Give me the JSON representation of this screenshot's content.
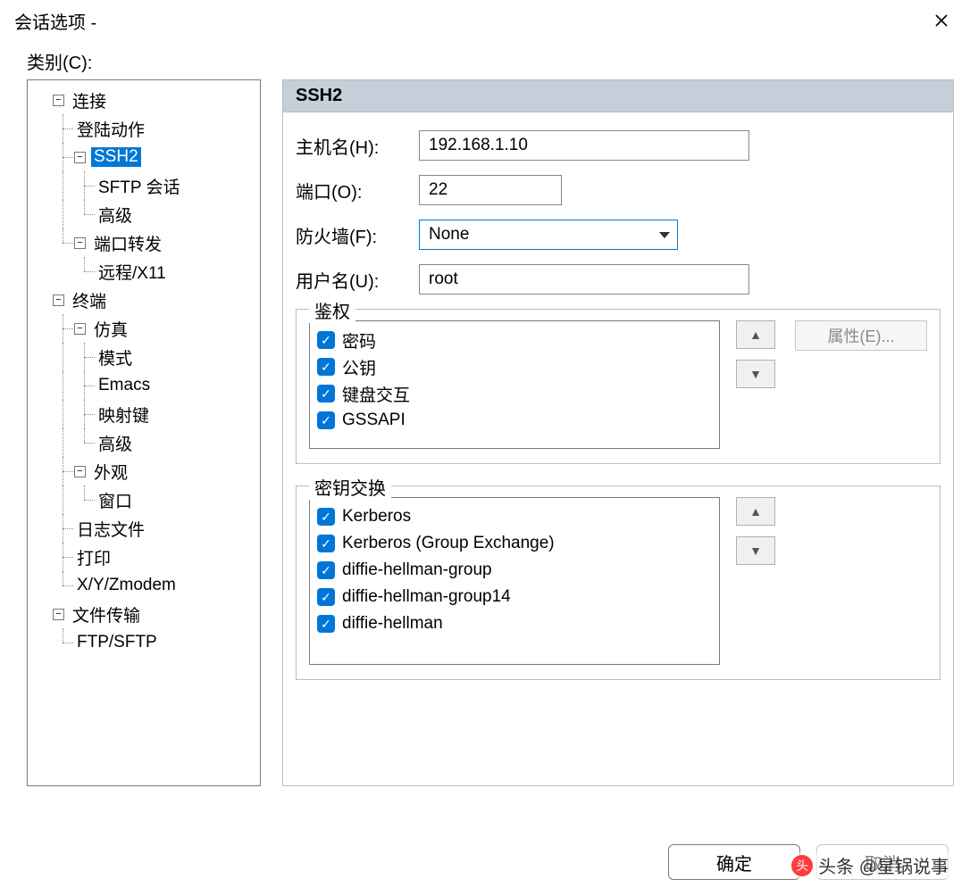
{
  "window": {
    "title": "会话选项 -",
    "category_label": "类别(C):"
  },
  "tree": {
    "connection": "连接",
    "login_actions": "登陆动作",
    "ssh2": "SSH2",
    "sftp_session": "SFTP 会话",
    "advanced1": "高级",
    "port_forward": "端口转发",
    "remote_x11": "远程/X11",
    "terminal": "终端",
    "emulation": "仿真",
    "modes": "模式",
    "emacs": "Emacs",
    "mapped_keys": "映射键",
    "advanced2": "高级",
    "appearance": "外观",
    "window": "窗口",
    "log_file": "日志文件",
    "printing": "打印",
    "xyzmodem": "X/Y/Zmodem",
    "file_transfer": "文件传输",
    "ftp_sftp": "FTP/SFTP"
  },
  "panel": {
    "title": "SSH2",
    "host_label": "主机名(H):",
    "host_value": "192.168.1.10",
    "port_label": "端口(O):",
    "port_value": "22",
    "firewall_label": "防火墙(F):",
    "firewall_value": "None",
    "user_label": "用户名(U):",
    "user_value": "root"
  },
  "auth": {
    "legend": "鉴权",
    "items": [
      "密码",
      "公钥",
      "键盘交互",
      "GSSAPI"
    ],
    "properties_btn": "属性(E)..."
  },
  "kex": {
    "legend": "密钥交换",
    "items": [
      "Kerberos",
      "Kerberos (Group Exchange)",
      "diffie-hellman-group",
      "diffie-hellman-group14",
      "diffie-hellman"
    ]
  },
  "buttons": {
    "ok": "确定",
    "cancel": "取消"
  },
  "watermark": "头条 @星锅说事"
}
